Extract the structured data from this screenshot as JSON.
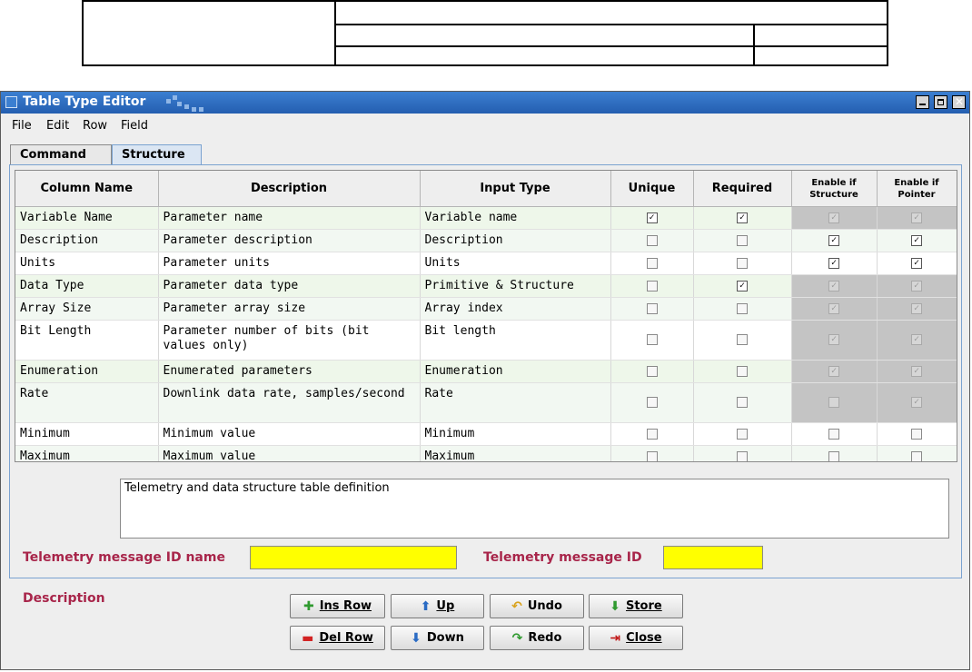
{
  "window": {
    "title": "Table Type Editor"
  },
  "menu": [
    "File",
    "Edit",
    "Row",
    "Field"
  ],
  "tabs": [
    {
      "label": "Command",
      "active": false
    },
    {
      "label": "Structure",
      "active": true
    }
  ],
  "table": {
    "columns": [
      "Column Name",
      "Description",
      "Input Type",
      "Unique",
      "Required",
      "Enable if\nStructure",
      "Enable if\nPointer"
    ],
    "rows": [
      {
        "name": "Variable Name",
        "description": "Parameter name",
        "input_type": "Variable name",
        "unique": true,
        "required": true,
        "enable_structure": true,
        "enable_pointer": true,
        "disabled": [
          false,
          false,
          true,
          true
        ]
      },
      {
        "name": "Description",
        "description": "Parameter description",
        "input_type": "Description",
        "unique": false,
        "required": false,
        "enable_structure": true,
        "enable_pointer": true,
        "disabled": [
          false,
          false,
          false,
          false
        ]
      },
      {
        "name": "Units",
        "description": "Parameter units",
        "input_type": "Units",
        "unique": false,
        "required": false,
        "enable_structure": true,
        "enable_pointer": true,
        "disabled": [
          false,
          false,
          false,
          false
        ]
      },
      {
        "name": "Data Type",
        "description": "Parameter data type",
        "input_type": "Primitive & Structure",
        "unique": false,
        "required": true,
        "enable_structure": true,
        "enable_pointer": true,
        "disabled": [
          false,
          false,
          true,
          true
        ]
      },
      {
        "name": "Array Size",
        "description": "Parameter array size",
        "input_type": "Array index",
        "unique": false,
        "required": false,
        "enable_structure": true,
        "enable_pointer": true,
        "disabled": [
          false,
          false,
          true,
          true
        ]
      },
      {
        "name": "Bit Length",
        "description": "Parameter number of bits (bit values only)",
        "input_type": "Bit length",
        "unique": false,
        "required": false,
        "enable_structure": true,
        "enable_pointer": true,
        "disabled": [
          false,
          false,
          true,
          true
        ]
      },
      {
        "name": "Enumeration",
        "description": "Enumerated parameters",
        "input_type": "Enumeration",
        "unique": false,
        "required": false,
        "enable_structure": true,
        "enable_pointer": true,
        "disabled": [
          false,
          false,
          true,
          true
        ]
      },
      {
        "name": "Rate",
        "description": "Downlink data rate, samples/second",
        "input_type": "Rate",
        "unique": false,
        "required": false,
        "enable_structure": false,
        "enable_pointer": true,
        "disabled": [
          false,
          false,
          true,
          true
        ]
      },
      {
        "name": "Minimum",
        "description": "Minimum value",
        "input_type": "Minimum",
        "unique": false,
        "required": false,
        "enable_structure": false,
        "enable_pointer": false,
        "disabled": [
          false,
          false,
          false,
          false
        ]
      },
      {
        "name": "Maximum",
        "description": "Maximum value",
        "input_type": "Maximum",
        "unique": false,
        "required": false,
        "enable_structure": false,
        "enable_pointer": false,
        "disabled": [
          false,
          false,
          false,
          false
        ]
      }
    ]
  },
  "description": {
    "label": "Description",
    "value": "Telemetry and data structure table definition"
  },
  "telemetry": {
    "name_label": "Telemetry message ID name",
    "name_value": "",
    "id_label": "Telemetry message ID",
    "id_value": ""
  },
  "buttons": {
    "ins_row": "Ins Row",
    "up": "Up",
    "undo": "Undo",
    "store": "Store",
    "del_row": "Del Row",
    "down": "Down",
    "redo": "Redo",
    "close": "Close"
  },
  "colors": {
    "title_bar": "#245eb0",
    "label": "#a8254a",
    "input_highlight": "#ffff00",
    "disabled_cell": "#c4c4c4"
  }
}
